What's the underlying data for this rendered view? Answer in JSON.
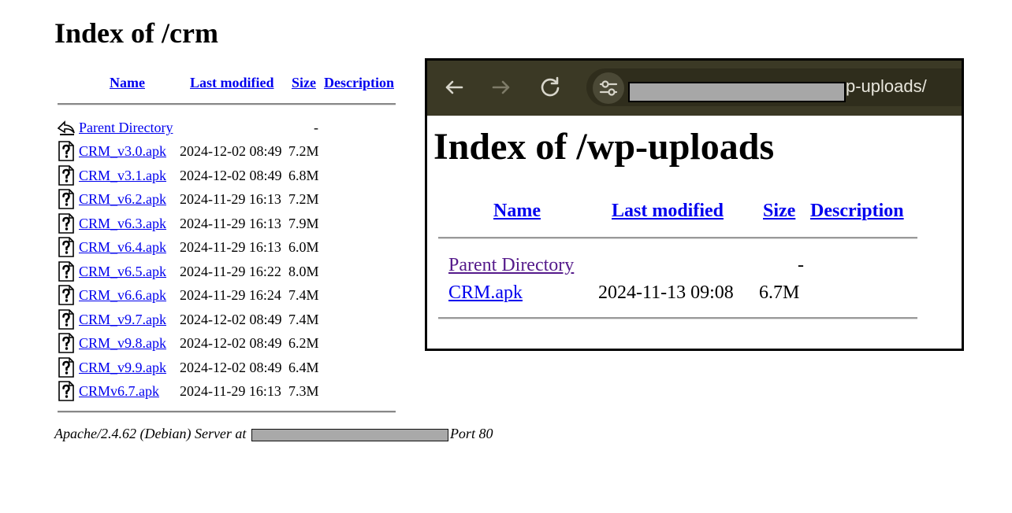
{
  "listing": {
    "title": "Index of /crm",
    "columns": {
      "name": "Name",
      "last_modified": "Last modified",
      "size": "Size",
      "description": "Description"
    },
    "parent": {
      "label": "Parent Directory",
      "size": "-"
    },
    "files": [
      {
        "name": "CRM_v3.0.apk",
        "modified": "2024-12-02 08:49",
        "size": "7.2M"
      },
      {
        "name": "CRM_v3.1.apk",
        "modified": "2024-12-02 08:49",
        "size": "6.8M"
      },
      {
        "name": "CRM_v6.2.apk",
        "modified": "2024-11-29 16:13",
        "size": "7.2M"
      },
      {
        "name": "CRM_v6.3.apk",
        "modified": "2024-11-29 16:13",
        "size": "7.9M"
      },
      {
        "name": "CRM_v6.4.apk",
        "modified": "2024-11-29 16:13",
        "size": "6.0M"
      },
      {
        "name": "CRM_v6.5.apk",
        "modified": "2024-11-29 16:22",
        "size": "8.0M"
      },
      {
        "name": "CRM_v6.6.apk",
        "modified": "2024-11-29 16:24",
        "size": "7.4M"
      },
      {
        "name": "CRM_v9.7.apk",
        "modified": "2024-12-02 08:49",
        "size": "7.4M"
      },
      {
        "name": "CRM_v9.8.apk",
        "modified": "2024-12-02 08:49",
        "size": "6.2M"
      },
      {
        "name": "CRM_v9.9.apk",
        "modified": "2024-12-02 08:49",
        "size": "6.4M"
      },
      {
        "name": "CRMv6.7.apk",
        "modified": "2024-11-29 16:13",
        "size": "7.3M"
      }
    ],
    "footer": {
      "prefix": "Apache/2.4.62 (Debian) Server at",
      "suffix": "Port 80"
    }
  },
  "browser": {
    "toolbar": {
      "back_icon": "arrow-left-icon",
      "forward_icon": "arrow-right-icon",
      "reload_icon": "reload-icon",
      "site_settings_icon": "tune-icon"
    },
    "address_tail": "p-uploads/",
    "title": "Index of /wp-uploads",
    "columns": {
      "name": "Name",
      "last_modified": "Last modified",
      "size": "Size",
      "description": "Description"
    },
    "parent": {
      "label": "Parent Directory",
      "size": "-"
    },
    "files": [
      {
        "name": "CRM.apk",
        "modified": "2024-11-13 09:08",
        "size": "6.7M"
      }
    ]
  },
  "colors": {
    "link": "#0000ee",
    "visited": "#551a8b",
    "toolbar_bg": "#3b3925"
  }
}
